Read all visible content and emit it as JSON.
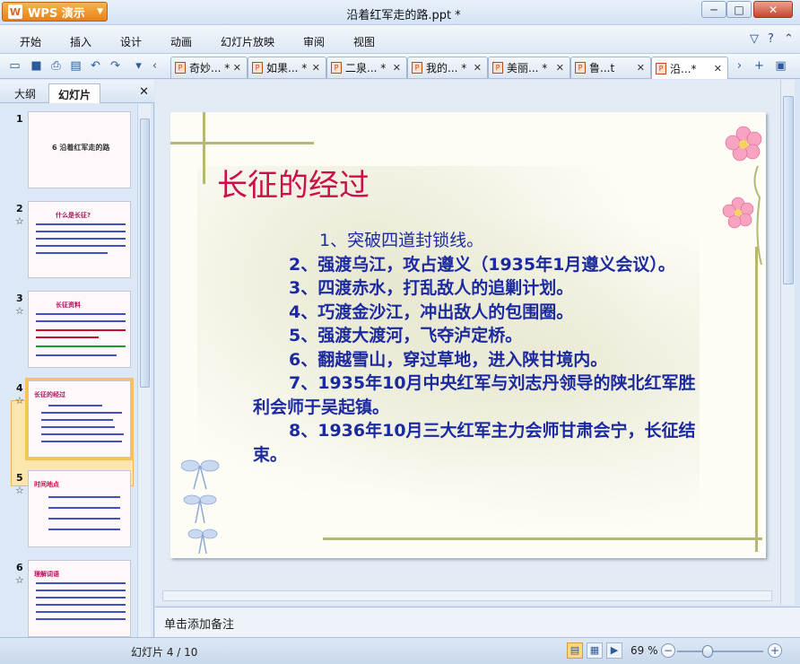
{
  "app": {
    "name": "WPS 演示",
    "logo": "W",
    "window_title": "沿着红军走的路.ppt *"
  },
  "window_controls": {
    "minimize": "─",
    "maximize": "□",
    "close": "✕"
  },
  "menu": {
    "items": [
      "开始",
      "插入",
      "设计",
      "动画",
      "幻灯片放映",
      "审阅",
      "视图"
    ],
    "right_icons": [
      "settings-icon",
      "help-icon",
      "minimize-ribbon-icon"
    ]
  },
  "toolbar": {
    "icons": [
      "open-icon",
      "save-icon",
      "print-icon",
      "print-preview-icon",
      "undo-icon",
      "redo-icon",
      "toolbar-menu-icon",
      "tabs-scroll-left-icon"
    ]
  },
  "doc_tabs": [
    {
      "label": "奇妙... *",
      "active": false
    },
    {
      "label": "如果... *",
      "active": false
    },
    {
      "label": "二泉... *",
      "active": false
    },
    {
      "label": "我的... *",
      "active": false
    },
    {
      "label": "美丽... *",
      "active": false
    },
    {
      "label": "鲁...t",
      "active": false
    },
    {
      "label": "沿...*",
      "active": true
    }
  ],
  "left_panel": {
    "tabs": [
      "大纲",
      "幻灯片"
    ],
    "active_tab": "幻灯片",
    "close": "✕",
    "thumbnails": [
      {
        "num": "1",
        "title": "6 沿着红军走的路",
        "star": false
      },
      {
        "num": "2",
        "title": "什么是长征?",
        "star": true
      },
      {
        "num": "3",
        "title": "长征资料",
        "star": true
      },
      {
        "num": "4",
        "title": "长征的经过",
        "star": true,
        "selected": true
      },
      {
        "num": "5",
        "title": "时间地点",
        "star": true
      },
      {
        "num": "6",
        "title": "理解词语",
        "star": true
      }
    ],
    "star_glyph": "☆"
  },
  "slide": {
    "title": "长征的经过",
    "items": [
      "1、突破四道封锁线。",
      "2、强渡乌江，攻占遵义（1935年1月遵义会议）。",
      "3、四渡赤水，打乱敌人的追剿计划。",
      "4、巧渡金沙江，冲出敌人的包围圈。",
      "5、强渡大渡河，飞夺泸定桥。",
      "6、翻越雪山，穿过草地，进入陕甘境内。",
      "7、1935年10月中央红军与刘志丹领导的陕北红军胜利会师于吴起镇。",
      "8、1936年10月三大红军主力会师甘肃会宁，长征结束。"
    ],
    "title_color": "#c8104a",
    "body_color": "#1c2aa0"
  },
  "notes": {
    "placeholder": "单击添加备注"
  },
  "status": {
    "slide_counter": "幻灯片 4 / 10",
    "zoom": "69 %",
    "zoom_level": 0.35,
    "view_icons": [
      "normal-view-icon",
      "slide-sorter-icon",
      "slideshow-icon"
    ]
  }
}
